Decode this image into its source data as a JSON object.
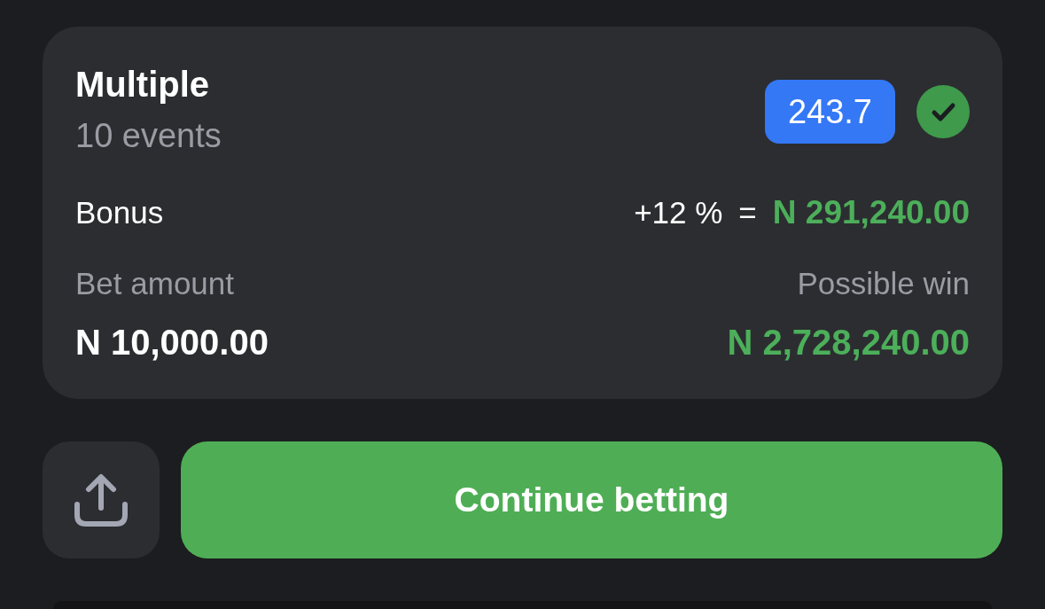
{
  "bet": {
    "title": "Multiple",
    "subtitle": "10 events",
    "odds": "243.7",
    "confirmed": true,
    "bonus": {
      "label": "Bonus",
      "percent": "+12 %",
      "equals": "=",
      "amount": "N 291,240.00"
    },
    "bet_amount": {
      "label": "Bet amount",
      "value": "N 10,000.00"
    },
    "possible_win": {
      "label": "Possible win",
      "value": "N 2,728,240.00"
    }
  },
  "actions": {
    "continue_button": "Continue betting"
  }
}
